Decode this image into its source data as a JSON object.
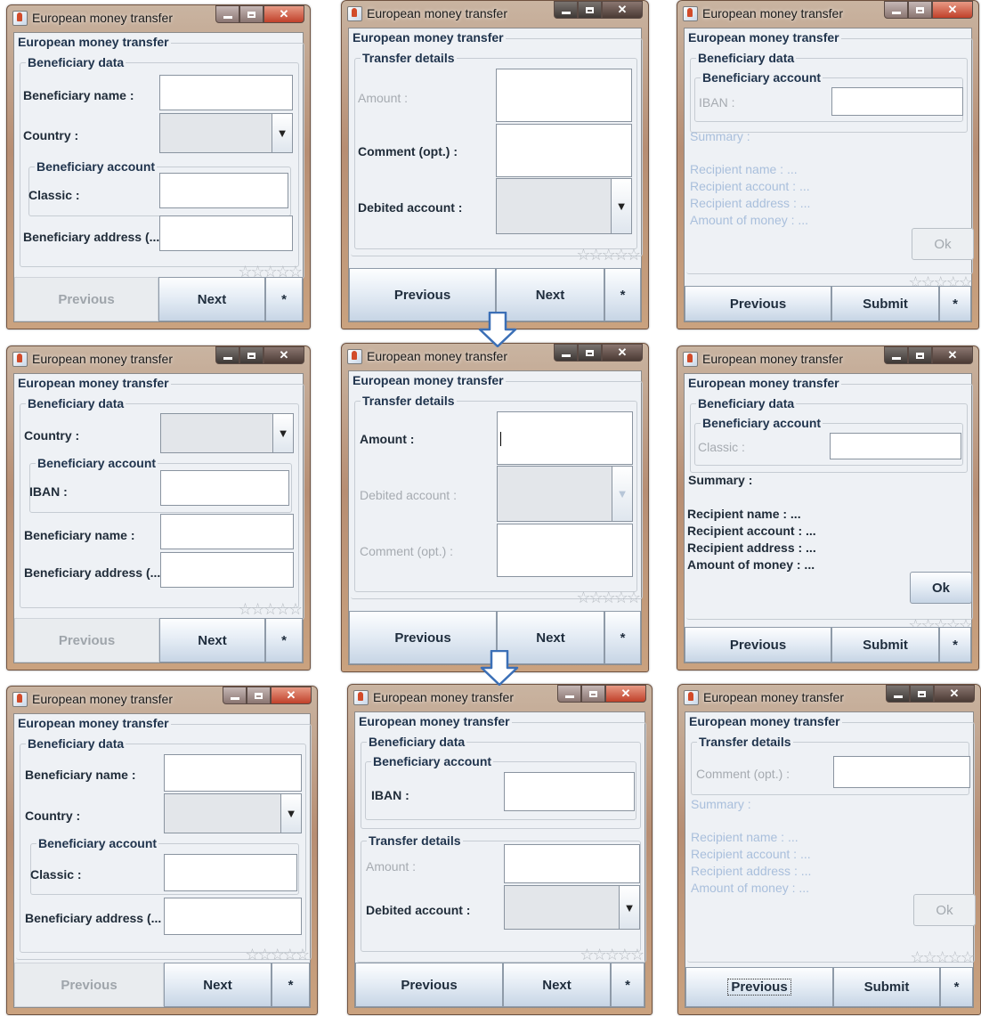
{
  "common": {
    "title": "European money transfer",
    "group_main": "European money transfer",
    "beneficiary_data": "Beneficiary data",
    "beneficiary_account": "Beneficiary account",
    "transfer_details": "Transfer details",
    "beneficiary_name": "Beneficiary name :",
    "country": "Country :",
    "classic": "Classic :",
    "iban": "IBAN :",
    "beneficiary_address": "Beneficiary address (...",
    "amount": "Amount :",
    "comment": "Comment (opt.) :",
    "debited_account": "Debited account :",
    "summary": "Summary :",
    "recipient_name": "Recipient name : ...",
    "recipient_account": "Recipient account : ...",
    "recipient_address": "Recipient address : ...",
    "amount_of_money": "Amount of money : ...",
    "ok": "Ok",
    "previous": "Previous",
    "next": "Next",
    "submit": "Submit",
    "star": "*",
    "stars": "☆☆☆☆☆",
    "arrow_icon": "down-arrow-icon",
    "combo_arrow": "▼"
  },
  "colors": {
    "frame": "#b78e73",
    "panel": "#eef1f5",
    "group_title": "#20344d",
    "disabled_text": "#a6abb1",
    "summary_disabled": "#a9bfdc",
    "arrow": "#3b6fb6"
  }
}
